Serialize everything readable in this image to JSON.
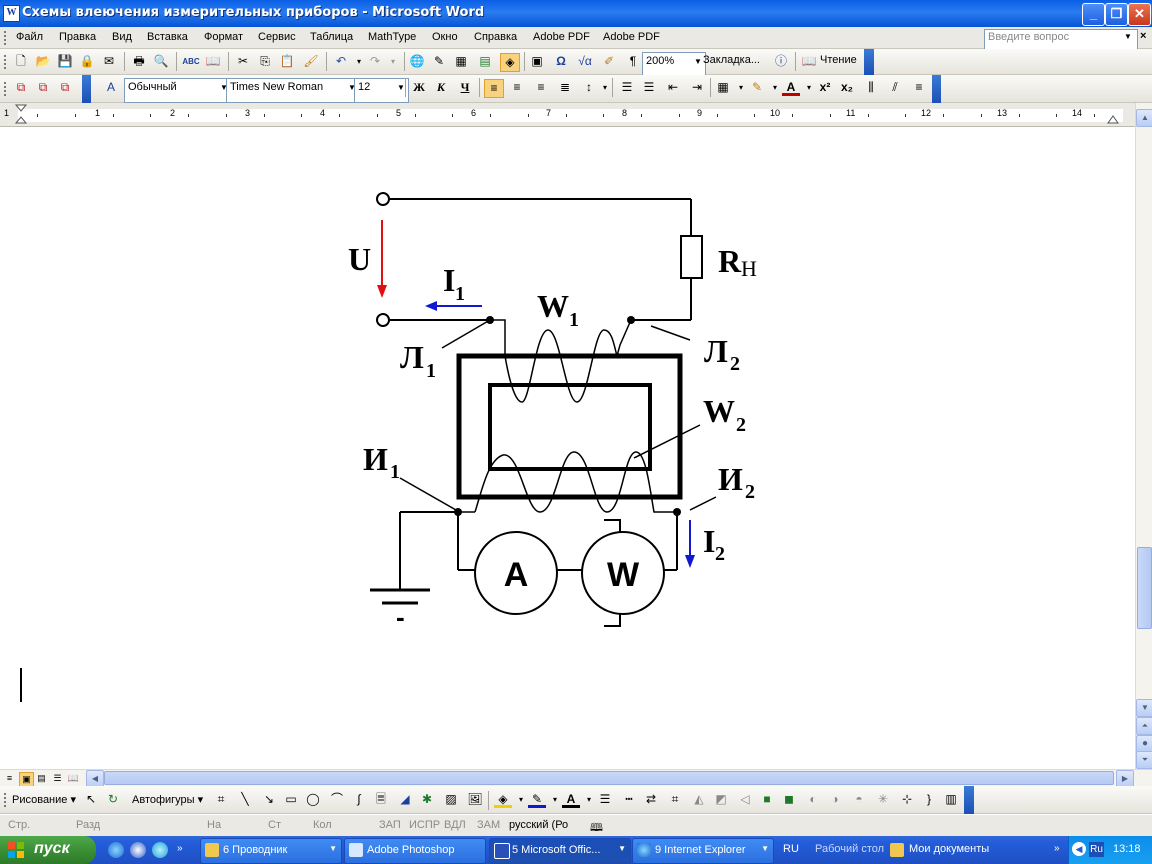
{
  "window": {
    "title": "Схемы влеючения измерительных приборов - Microsoft Word",
    "icon_letter": "W"
  },
  "menu": {
    "items": [
      "Файл",
      "Правка",
      "Вид",
      "Вставка",
      "Формат",
      "Сервис",
      "Таблица",
      "MathType",
      "Окно",
      "Справка",
      "Adobe PDF",
      "Adobe PDF"
    ],
    "ask_placeholder": "Введите вопрос"
  },
  "standard_toolbar": {
    "zoom": "200%",
    "bookmark": "Закладка...",
    "reading": "Чтение"
  },
  "format_toolbar": {
    "style": "Обычный",
    "font": "Times New Roman",
    "size": "12",
    "bold": "Ж",
    "italic": "К",
    "underline": "Ч"
  },
  "ruler": {
    "labels": [
      "1",
      "2",
      "1",
      "2",
      "3",
      "4",
      "5",
      "6",
      "7",
      "8",
      "9",
      "10",
      "11",
      "12",
      "13",
      "14"
    ]
  },
  "diagram": {
    "U": "U",
    "I1": "I",
    "I1_sub": "1",
    "W1": "W",
    "W1_sub": "1",
    "W2": "W",
    "W2_sub": "2",
    "RH": "R",
    "RH_sub": "Н",
    "L1": "Л",
    "L1_sub": "1",
    "L2": "Л",
    "L2_sub": "2",
    "I_1": "И",
    "I_1_sub": "1",
    "I_2": "И",
    "I_2_sub": "2",
    "I2": "I",
    "I2_sub": "2",
    "ammeter": "A",
    "wattmeter": "W",
    "ground_sign": "-",
    "colors": {
      "voltage_arrow": "#e01010",
      "current_arrow": "#1018d0"
    }
  },
  "draw_toolbar": {
    "drawing": "Рисование",
    "autoshapes": "Автофигуры"
  },
  "status": {
    "page": "Стр.",
    "section": "Разд",
    "at": "На",
    "line": "Ст",
    "col": "Кол",
    "rec": "ЗАП",
    "trk": "ИСПР",
    "ext": "ВДЛ",
    "ovr": "ЗАМ",
    "lang": "русский (Ро"
  },
  "taskbar": {
    "start": "пуск",
    "tasks": [
      {
        "label": "6 Проводник"
      },
      {
        "label": "Adobe Photoshop"
      },
      {
        "label": "5 Microsoft Offic..."
      },
      {
        "label": "9 Internet Explorer"
      }
    ],
    "lang": "RU",
    "desktop": "Рабочий стол",
    "mydocs": "Мои документы",
    "tray_lang": "Ru",
    "clock": "13:18"
  }
}
